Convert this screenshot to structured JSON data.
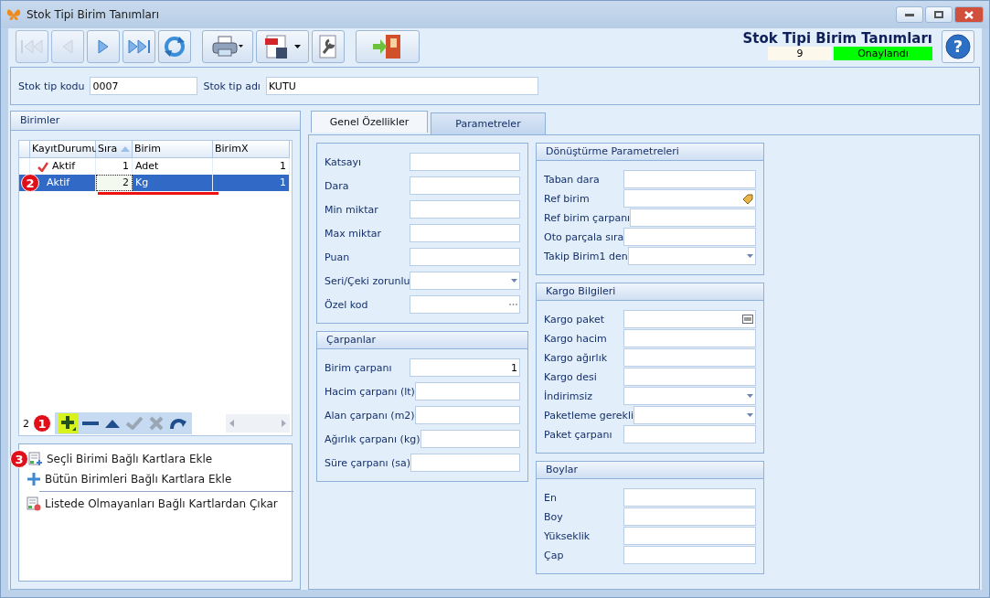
{
  "window": {
    "title": "Stok Tipi Birim Tanımları"
  },
  "toolbar": {
    "buttons": [
      {
        "kind": "first",
        "disabled": true
      },
      {
        "kind": "prev",
        "disabled": true
      },
      {
        "kind": "next",
        "disabled": false
      },
      {
        "kind": "last",
        "disabled": false
      },
      {
        "kind": "refresh",
        "disabled": false
      },
      {
        "kind": "print",
        "disabled": false
      },
      {
        "kind": "pdf",
        "disabled": false
      },
      {
        "kind": "tools",
        "disabled": false
      },
      {
        "kind": "exit",
        "disabled": false
      }
    ]
  },
  "header": {
    "title": "Stok Tipi Birim Tanımları",
    "record_number": "9",
    "status": "Onaylandı",
    "help": "?"
  },
  "form": {
    "fields": [
      {
        "label": "Stok tip kodu",
        "value": "0007"
      },
      {
        "label": "Stok tip adı",
        "value": "KUTU"
      }
    ]
  },
  "birimler": {
    "title": "Birimler",
    "table": {
      "columns": [
        {
          "label": "KayıtDurumu",
          "sorted": false
        },
        {
          "label": "Sıra",
          "sorted": true
        },
        {
          "label": "Birim",
          "sorted": false
        },
        {
          "label": "BirimX",
          "sorted": false
        }
      ],
      "rows": [
        {
          "status": "Aktif",
          "checked": true,
          "sira": "1",
          "birim": "Adet",
          "birimx": "1",
          "selected": false
        },
        {
          "status": "Aktif",
          "checked": false,
          "sira": "2",
          "birim": "Kg",
          "birimx": "1",
          "selected": true
        }
      ]
    },
    "navigator_count": "2",
    "actions": [
      {
        "label": "Seçli Birimi Bağlı Kartlara Ekle",
        "kind": "add-doc"
      },
      {
        "label": "Bütün Birimleri Bağlı Kartlara Ekle",
        "kind": "plus"
      },
      {
        "label": "Listede Olmayanları Bağlı Kartlardan Çıkar",
        "kind": "remove-doc"
      }
    ]
  },
  "annotations": [
    {
      "label": "1"
    },
    {
      "label": "2"
    },
    {
      "label": "3"
    }
  ],
  "tabs": [
    {
      "label": "Genel Özellikler",
      "selected": true
    },
    {
      "label": "Parametreler",
      "selected": false
    }
  ],
  "groups_left": [
    {
      "fields": [
        {
          "label": "Katsayı",
          "kind": "text"
        },
        {
          "label": "Dara",
          "kind": "text"
        },
        {
          "label": "Min miktar",
          "kind": "text"
        },
        {
          "label": "Max miktar",
          "kind": "text"
        },
        {
          "label": "Puan",
          "kind": "text"
        },
        {
          "label": "Seri/Çeki zorunlu",
          "kind": "dropdown"
        },
        {
          "label": "Özel kod",
          "kind": "ellipsis"
        }
      ]
    },
    {
      "title": "Çarpanlar",
      "fields": [
        {
          "label": "Birim çarpanı",
          "kind": "text",
          "value": "1"
        },
        {
          "label": "Hacim çarpanı (lt)",
          "kind": "text"
        },
        {
          "label": "Alan çarpanı (m2)",
          "kind": "text"
        },
        {
          "label": "Ağırlık çarpanı (kg)",
          "kind": "text"
        },
        {
          "label": "Süre çarpanı (sa)",
          "kind": "text"
        }
      ]
    }
  ],
  "groups_right": [
    {
      "title": "Dönüştürme Parametreleri",
      "fields": [
        {
          "label": "Taban dara",
          "kind": "text"
        },
        {
          "label": "Ref birim",
          "kind": "tag"
        },
        {
          "label": "Ref birim çarpanı",
          "kind": "text"
        },
        {
          "label": "Oto parçala sıra",
          "kind": "text"
        },
        {
          "label": "Takip Birim1 den",
          "kind": "dropdown"
        }
      ]
    },
    {
      "title": "Kargo Bilgileri",
      "fields": [
        {
          "label": "Kargo paket",
          "kind": "barcode"
        },
        {
          "label": "Kargo hacim",
          "kind": "text"
        },
        {
          "label": "Kargo ağırlık",
          "kind": "text"
        },
        {
          "label": "Kargo desi",
          "kind": "text"
        },
        {
          "label": "İndirimsiz",
          "kind": "dropdown"
        },
        {
          "label": "Paketleme gerekli",
          "kind": "dropdown"
        },
        {
          "label": "Paket çarpanı",
          "kind": "text"
        }
      ]
    },
    {
      "title": "Boylar",
      "fields": [
        {
          "label": "En",
          "kind": "text"
        },
        {
          "label": "Boy",
          "kind": "text"
        },
        {
          "label": "Yükseklik",
          "kind": "text"
        },
        {
          "label": "Çap",
          "kind": "text"
        }
      ]
    }
  ]
}
